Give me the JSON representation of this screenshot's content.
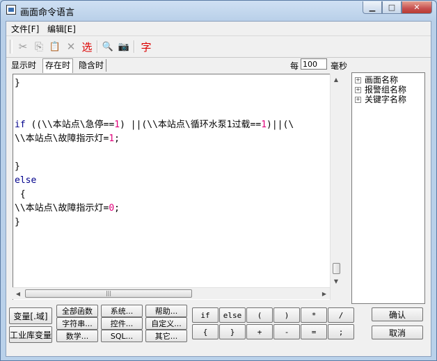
{
  "window": {
    "title": "画面命令语言"
  },
  "menu": [
    {
      "label": "文件[F]"
    },
    {
      "label": "编辑[E]"
    }
  ],
  "toolbar": {
    "cut": "✂",
    "copy": "⎘",
    "paste": "📋",
    "delete": "✕",
    "select": "选",
    "find": "🔍",
    "camera": "📷",
    "font": "字"
  },
  "tabs": [
    {
      "label": "显示时"
    },
    {
      "label": "存在时"
    },
    {
      "label": "隐含时"
    }
  ],
  "timer": {
    "every_label": "每",
    "value": "100",
    "unit_label": "毫秒"
  },
  "tree": [
    {
      "label": "画面名称"
    },
    {
      "label": "报警组名称"
    },
    {
      "label": "关键字名称"
    }
  ],
  "code_lines": [
    "}",
    "",
    "",
    "if ((\\\\本站点\\急停==1) ||(\\\\本站点\\循环水泵1过载==1)||(\\",
    "\\\\本站点\\故障指示灯=1;",
    "",
    "}",
    "else",
    " {",
    "\\\\本站点\\故障指示灯=0;",
    "}"
  ],
  "buttons": {
    "var_domain": "变量[.域]",
    "lib_var": "工业库变量",
    "all_funcs": "全部函数",
    "string": "字符串...",
    "math": "数学...",
    "system": "系统...",
    "control": "控件...",
    "sql": "SQL...",
    "help": "帮助...",
    "custom": "自定义...",
    "other": "其它...",
    "confirm": "确认",
    "cancel": "取消"
  },
  "operators": [
    "if",
    "else",
    "(",
    ")",
    "*",
    "/",
    "{",
    "}",
    "+",
    "-",
    "=",
    ";"
  ]
}
